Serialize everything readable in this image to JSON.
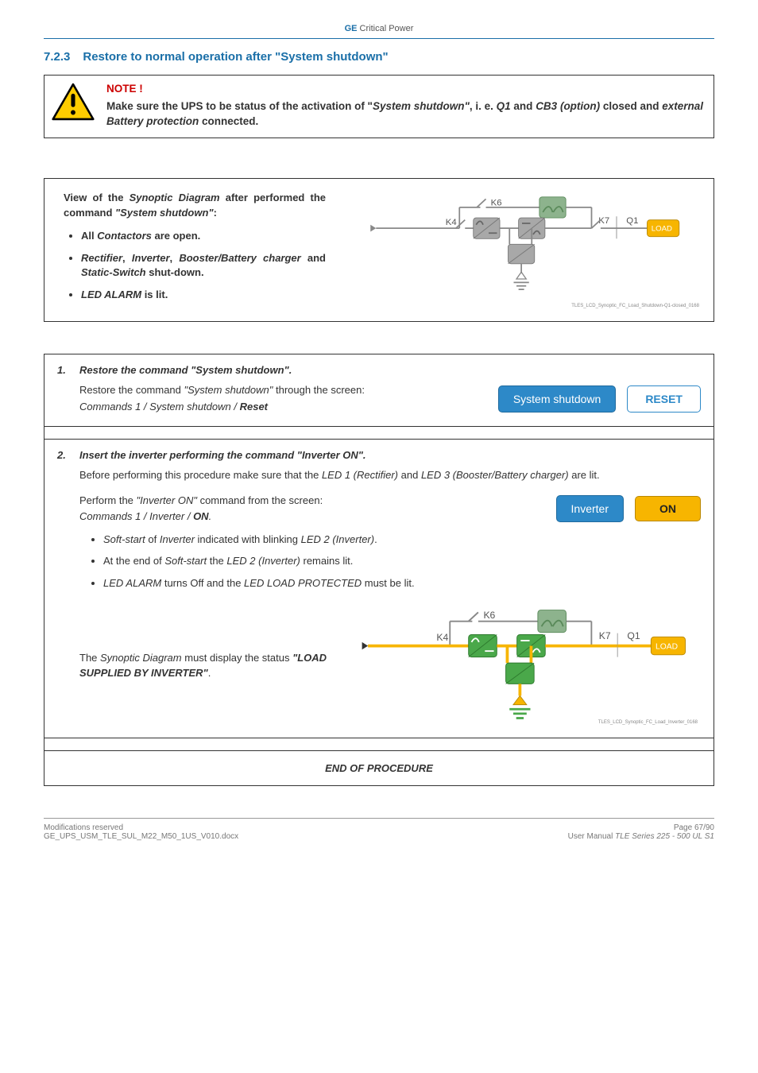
{
  "header": {
    "ge": "GE",
    "cp": "Critical Power"
  },
  "section": {
    "num": "7.2.3",
    "title": "Restore to normal operation after \"System shutdown\""
  },
  "note": {
    "hdr": "NOTE !",
    "body_parts": [
      {
        "t": "Make sure the UPS to be status of the activation of \"",
        "bold": true
      },
      {
        "t": "System shutdown\"",
        "bold": true,
        "ital": true
      },
      {
        "t": ", i. e. ",
        "bold": true
      },
      {
        "t": "Q1",
        "bold": true,
        "ital": true
      },
      {
        "t": " and ",
        "bold": true
      },
      {
        "t": "CB3 (option)",
        "bold": true,
        "ital": true
      },
      {
        "t": " closed and ",
        "bold": true
      },
      {
        "t": "external Battery protection",
        "bold": true,
        "ital": true
      },
      {
        "t": " connected.",
        "bold": true
      }
    ]
  },
  "view": {
    "intro": {
      "pre": "View of the ",
      "syn": "Synoptic Diagram",
      "mid": " after performed the command ",
      "cmd": "\"System shutdown\"",
      "post": ":"
    },
    "bullet1": {
      "pre": "All ",
      "ital": "Contactors",
      "post": " are open."
    },
    "bullet2": {
      "pre": "",
      "parts": [
        {
          "t": "Rectifier",
          "ital": true
        },
        {
          "t": ", "
        },
        {
          "t": "Inverter",
          "ital": true
        },
        {
          "t": ", "
        },
        {
          "t": "Booster/Battery charger",
          "ital": true
        },
        {
          "t": " and "
        },
        {
          "t": "Static-Switch",
          "ital": true
        },
        {
          "t": " shut-down."
        }
      ]
    },
    "bullet3": {
      "ital": "LED ALARM",
      "post": " is lit."
    },
    "diagram": {
      "k4": "K4",
      "k6": "K6",
      "k7": "K7",
      "q1": "Q1",
      "load": "LOAD",
      "tag": "TLES_LCD_Synoptic_FC_Load_Shutdown-Q1-closed_0168"
    }
  },
  "step1": {
    "num": "1.",
    "title": "Restore the command \"System shutdown\".",
    "line1_pre": "Restore the command ",
    "line1_ital": "\"System shutdown\"",
    "line1_post": " through the screen:",
    "line2_pre": "Commands 1 / System shutdown / ",
    "line2_bold": "Reset",
    "pill_label": "System shutdown",
    "pill_action": "RESET"
  },
  "step2": {
    "num": "2.",
    "title": "Insert the inverter performing the command \"Inverter ON\".",
    "para1_pre": "Before performing this procedure make sure that the ",
    "para1_led1": "LED 1 (Rectifier)",
    "para1_mid": " and ",
    "para1_led3": "LED 3 (Booster/Battery charger)",
    "para1_post": " are lit.",
    "para2_pre": "Perform the ",
    "para2_ital": "\"Inverter ON\"",
    "para2_mid": " command from the screen:",
    "para2_cmd_pre": "Commands 1 / Inverter / ",
    "para2_cmd_bold": "ON",
    "para2_cmd_post": ".",
    "pill_label": "Inverter",
    "pill_action": "ON",
    "sb1": {
      "pre": "Soft-start",
      "mid": " of ",
      "inv": "Inverter",
      "mid2": " indicated with blinking ",
      "led": "LED 2 (Inverter)",
      "post": "."
    },
    "sb2": {
      "pre": "At the end of ",
      "ss": "Soft-start",
      "mid": " the ",
      "led": "LED 2 (Inverter)",
      "post": " remains lit."
    },
    "sb3": {
      "la": "LED ALARM",
      "mid": " turns Off and the ",
      "llp": "LED LOAD PROTECTED",
      "post": " must be lit."
    },
    "diag_txt_pre": "The ",
    "diag_txt_syn": "Synoptic Diagram",
    "diag_txt_mid": " must display the status ",
    "diag_txt_status": "\"LOAD SUPPLIED BY INVERTER\"",
    "diag_txt_post": ".",
    "diagram": {
      "k4": "K4",
      "k6": "K6",
      "k7": "K7",
      "q1": "Q1",
      "load": "LOAD",
      "tag": "TLES_LCD_Synoptic_FC_Load_Inverter_0168"
    }
  },
  "end": "END OF PROCEDURE",
  "footer": {
    "l1": "Modifications reserved",
    "l2": "GE_UPS_USM_TLE_SUL_M22_M50_1US_V010.docx",
    "r1": "Page 67/90",
    "r2_pre": "User Manual ",
    "r2_ital": "TLE Series 225 - 500 UL S1"
  }
}
